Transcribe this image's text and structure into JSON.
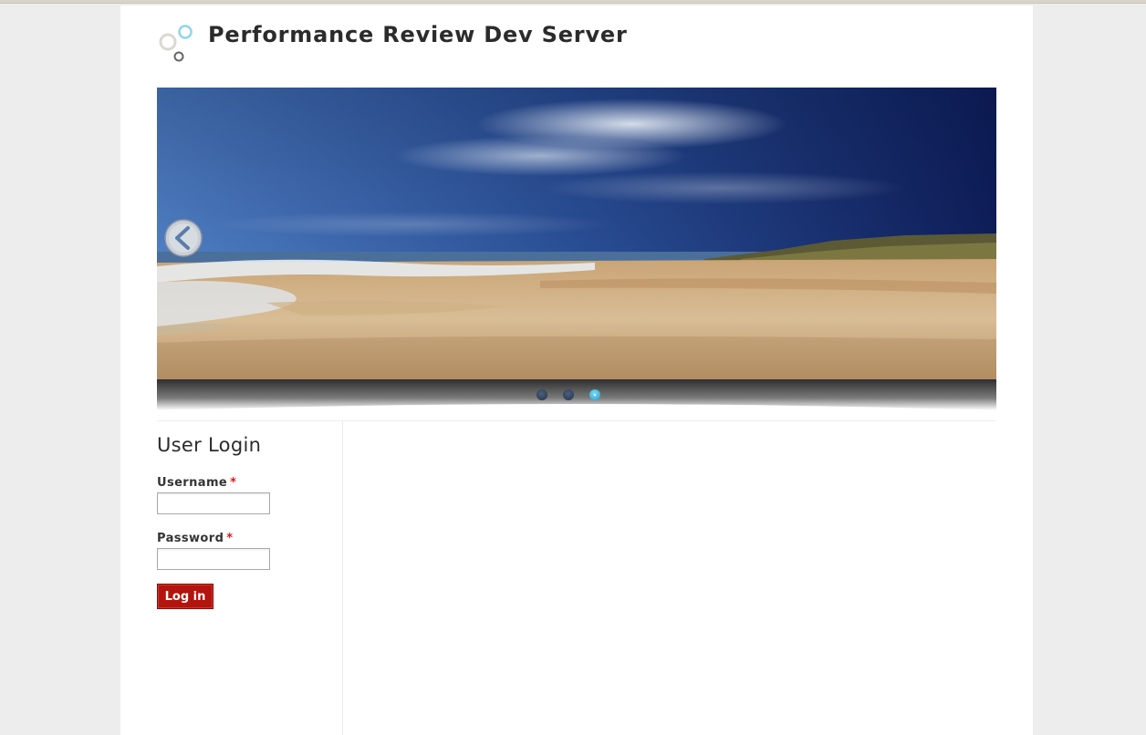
{
  "site": {
    "title": "Performance Review Dev Server"
  },
  "slider": {
    "dots_count": 3,
    "active_dot": 3
  },
  "login": {
    "title": "User Login",
    "username_label": "Username",
    "password_label": "Password",
    "required_marker": "*",
    "username_value": "",
    "password_value": "",
    "submit_label": "Log in"
  },
  "colors": {
    "accent_button": "#b3140d",
    "required": "#d81b1b",
    "active_dot": "#1d9ad0"
  }
}
